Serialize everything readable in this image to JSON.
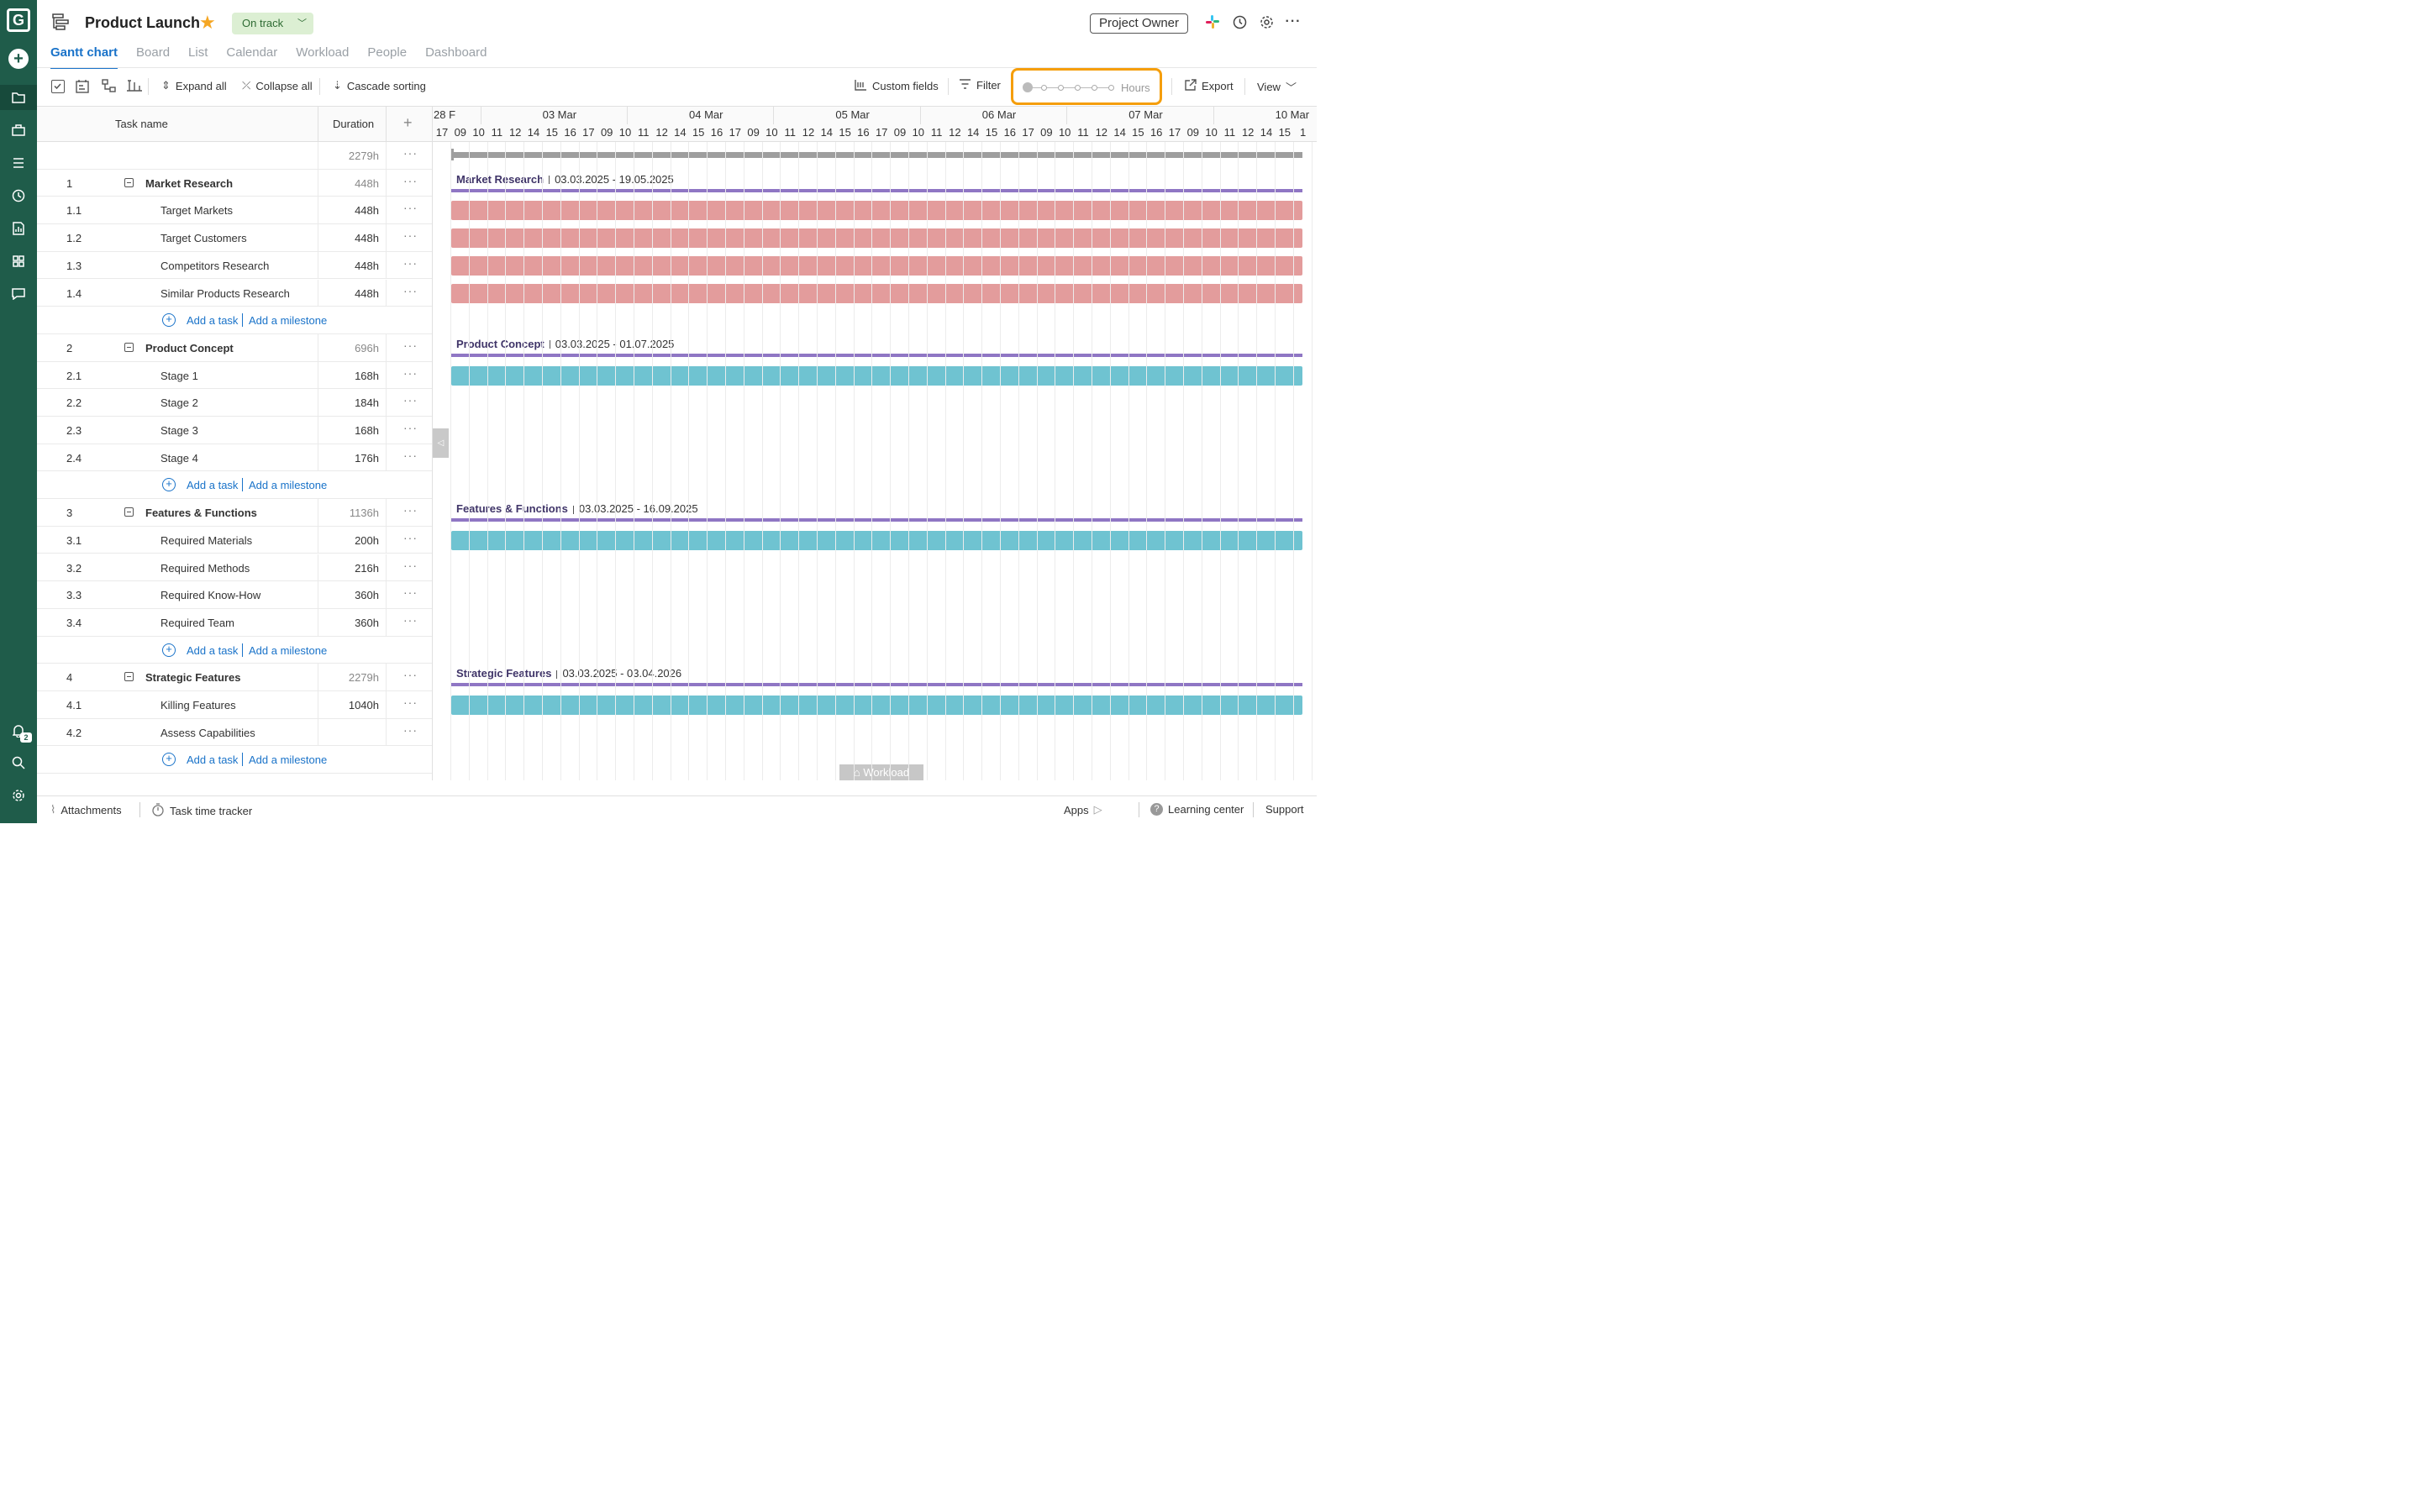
{
  "project": {
    "title": "Product Launch",
    "status": "On track",
    "owner_button": "Project Owner"
  },
  "tabs": [
    "Gantt chart",
    "Board",
    "List",
    "Calendar",
    "Workload",
    "People",
    "Dashboard"
  ],
  "toolbar": {
    "expand_all": "Expand all",
    "collapse_all": "Collapse all",
    "cascade_sorting": "Cascade sorting",
    "custom_fields": "Custom fields",
    "filter": "Filter",
    "zoom_label": "Hours",
    "export": "Export",
    "view": "View"
  },
  "grid": {
    "col_task": "Task name",
    "col_duration": "Duration",
    "total_duration": "2279h",
    "add_task": "Add a task",
    "add_milestone": "Add a milestone",
    "groups": [
      {
        "num": "1",
        "name": "Market Research",
        "duration": "448h",
        "range": "03.03.2025 - 19.05.2025",
        "tasks": [
          {
            "num": "1.1",
            "name": "Target Markets",
            "duration": "448h"
          },
          {
            "num": "1.2",
            "name": "Target Customers",
            "duration": "448h"
          },
          {
            "num": "1.3",
            "name": "Competitors Research",
            "duration": "448h"
          },
          {
            "num": "1.4",
            "name": "Similar Products Research",
            "duration": "448h"
          }
        ]
      },
      {
        "num": "2",
        "name": "Product Concept",
        "duration": "696h",
        "range": "03.03.2025 - 01.07.2025",
        "tasks": [
          {
            "num": "2.1",
            "name": "Stage 1",
            "duration": "168h"
          },
          {
            "num": "2.2",
            "name": "Stage 2",
            "duration": "184h"
          },
          {
            "num": "2.3",
            "name": "Stage 3",
            "duration": "168h"
          },
          {
            "num": "2.4",
            "name": "Stage 4",
            "duration": "176h"
          }
        ]
      },
      {
        "num": "3",
        "name": "Features & Functions",
        "duration": "1136h",
        "range": "03.03.2025 - 16.09.2025",
        "tasks": [
          {
            "num": "3.1",
            "name": "Required Materials",
            "duration": "200h"
          },
          {
            "num": "3.2",
            "name": "Required Methods",
            "duration": "216h"
          },
          {
            "num": "3.3",
            "name": "Required Know-How",
            "duration": "360h"
          },
          {
            "num": "3.4",
            "name": "Required Team",
            "duration": "360h"
          }
        ]
      },
      {
        "num": "4",
        "name": "Strategic Features",
        "duration": "2279h",
        "range": "03.03.2025 - 03.04.2026",
        "tasks": [
          {
            "num": "4.1",
            "name": "Killing Features",
            "duration": "1040h"
          },
          {
            "num": "4.2",
            "name": "Assess Capabilities",
            "duration": ""
          }
        ]
      }
    ]
  },
  "timeline": {
    "days": [
      "28 F",
      "03 Mar",
      "04 Mar",
      "05 Mar",
      "06 Mar",
      "07 Mar",
      "10 Mar"
    ],
    "hours": [
      "17",
      "09",
      "10",
      "11",
      "12",
      "14",
      "15",
      "16",
      "17",
      "09",
      "10",
      "11",
      "12",
      "14",
      "15",
      "16",
      "17",
      "09",
      "10",
      "11",
      "12",
      "14",
      "15",
      "16",
      "17",
      "09",
      "10",
      "11",
      "12",
      "14",
      "15",
      "16",
      "17",
      "09",
      "10",
      "11",
      "12",
      "14",
      "15",
      "16",
      "17",
      "09",
      "10",
      "11",
      "12",
      "14",
      "15",
      "1"
    ],
    "workload_tab": "Workload"
  },
  "footer": {
    "attachments": "Attachments",
    "time_tracker": "Task time tracker",
    "apps": "Apps",
    "learning": "Learning center",
    "support": "Support"
  },
  "colors": {
    "rail": "#1f5c4a",
    "accent": "#1a73c9",
    "highlight": "#f59e0b",
    "bar_pink": "#e39c9c",
    "bar_teal": "#6fc3d1",
    "group_line": "#8f76c4"
  }
}
